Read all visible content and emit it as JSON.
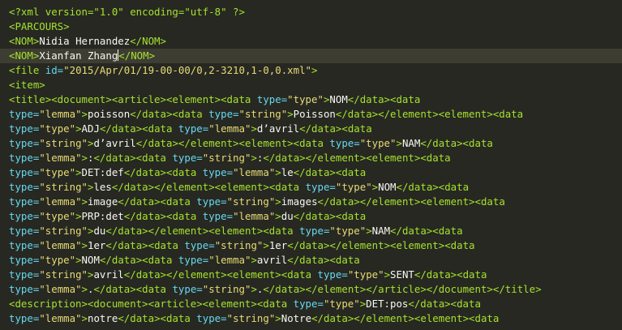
{
  "editor": {
    "theme_colors": {
      "background": "#272822",
      "tag": "#a6e22e",
      "text": "#f8f8f2",
      "attr_name": "#66d9ef",
      "attr_value": "#e6db74",
      "decl": "#a6e22e",
      "active_line": "#3e3d32"
    },
    "active_line_index": 3,
    "lines": [
      [
        {
          "t": "<?xml version=\"1.0\" encoding=\"utf-8\" ?>",
          "c": "decl"
        }
      ],
      [
        {
          "t": "<PARCOURS>",
          "c": "tag"
        }
      ],
      [
        {
          "t": "<NOM>",
          "c": "tag"
        },
        {
          "t": "Nidia Hernandez",
          "c": "text"
        },
        {
          "t": "</NOM>",
          "c": "tag"
        }
      ],
      [
        {
          "t": "<NOM>",
          "c": "tag"
        },
        {
          "t": "Xianfan Zhang",
          "c": "text"
        },
        {
          "t": "</NOM>",
          "c": "tag"
        }
      ],
      [
        {
          "t": "<file ",
          "c": "tag"
        },
        {
          "t": "id=",
          "c": "attr_name"
        },
        {
          "t": "\"2015/Apr/01/19-00-00/0,2-3210,1-0,0.xml\"",
          "c": "attr_value"
        },
        {
          "t": ">",
          "c": "tag"
        }
      ],
      [
        {
          "t": "<item>",
          "c": "tag"
        }
      ],
      [
        {
          "t": "<title><document><article><element><data ",
          "c": "tag"
        },
        {
          "t": "type=",
          "c": "attr_name"
        },
        {
          "t": "\"type\"",
          "c": "attr_value"
        },
        {
          "t": ">",
          "c": "tag"
        },
        {
          "t": "NOM",
          "c": "text"
        },
        {
          "t": "</data><data",
          "c": "tag"
        }
      ],
      [
        {
          "t": "type=",
          "c": "attr_name"
        },
        {
          "t": "\"lemma\"",
          "c": "attr_value"
        },
        {
          "t": ">",
          "c": "tag"
        },
        {
          "t": "poisson",
          "c": "text"
        },
        {
          "t": "</data><data ",
          "c": "tag"
        },
        {
          "t": "type=",
          "c": "attr_name"
        },
        {
          "t": "\"string\"",
          "c": "attr_value"
        },
        {
          "t": ">",
          "c": "tag"
        },
        {
          "t": "Poisson",
          "c": "text"
        },
        {
          "t": "</data></element><element><data",
          "c": "tag"
        }
      ],
      [
        {
          "t": "type=",
          "c": "attr_name"
        },
        {
          "t": "\"type\"",
          "c": "attr_value"
        },
        {
          "t": ">",
          "c": "tag"
        },
        {
          "t": "ADJ",
          "c": "text"
        },
        {
          "t": "</data><data ",
          "c": "tag"
        },
        {
          "t": "type=",
          "c": "attr_name"
        },
        {
          "t": "\"lemma\"",
          "c": "attr_value"
        },
        {
          "t": ">",
          "c": "tag"
        },
        {
          "t": "d’avril",
          "c": "text"
        },
        {
          "t": "</data><data",
          "c": "tag"
        }
      ],
      [
        {
          "t": "type=",
          "c": "attr_name"
        },
        {
          "t": "\"string\"",
          "c": "attr_value"
        },
        {
          "t": ">",
          "c": "tag"
        },
        {
          "t": "d’avril",
          "c": "text"
        },
        {
          "t": "</data></element><element><data ",
          "c": "tag"
        },
        {
          "t": "type=",
          "c": "attr_name"
        },
        {
          "t": "\"type\"",
          "c": "attr_value"
        },
        {
          "t": ">",
          "c": "tag"
        },
        {
          "t": "NAM",
          "c": "text"
        },
        {
          "t": "</data><data",
          "c": "tag"
        }
      ],
      [
        {
          "t": "type=",
          "c": "attr_name"
        },
        {
          "t": "\"lemma\"",
          "c": "attr_value"
        },
        {
          "t": ">",
          "c": "tag"
        },
        {
          "t": ":",
          "c": "text"
        },
        {
          "t": "</data><data ",
          "c": "tag"
        },
        {
          "t": "type=",
          "c": "attr_name"
        },
        {
          "t": "\"string\"",
          "c": "attr_value"
        },
        {
          "t": ">",
          "c": "tag"
        },
        {
          "t": ":",
          "c": "text"
        },
        {
          "t": "</data></element><element><data",
          "c": "tag"
        }
      ],
      [
        {
          "t": "type=",
          "c": "attr_name"
        },
        {
          "t": "\"type\"",
          "c": "attr_value"
        },
        {
          "t": ">",
          "c": "tag"
        },
        {
          "t": "DET:def",
          "c": "text"
        },
        {
          "t": "</data><data ",
          "c": "tag"
        },
        {
          "t": "type=",
          "c": "attr_name"
        },
        {
          "t": "\"lemma\"",
          "c": "attr_value"
        },
        {
          "t": ">",
          "c": "tag"
        },
        {
          "t": "le",
          "c": "text"
        },
        {
          "t": "</data><data",
          "c": "tag"
        }
      ],
      [
        {
          "t": "type=",
          "c": "attr_name"
        },
        {
          "t": "\"string\"",
          "c": "attr_value"
        },
        {
          "t": ">",
          "c": "tag"
        },
        {
          "t": "les",
          "c": "text"
        },
        {
          "t": "</data></element><element><data ",
          "c": "tag"
        },
        {
          "t": "type=",
          "c": "attr_name"
        },
        {
          "t": "\"type\"",
          "c": "attr_value"
        },
        {
          "t": ">",
          "c": "tag"
        },
        {
          "t": "NOM",
          "c": "text"
        },
        {
          "t": "</data><data",
          "c": "tag"
        }
      ],
      [
        {
          "t": "type=",
          "c": "attr_name"
        },
        {
          "t": "\"lemma\"",
          "c": "attr_value"
        },
        {
          "t": ">",
          "c": "tag"
        },
        {
          "t": "image",
          "c": "text"
        },
        {
          "t": "</data><data ",
          "c": "tag"
        },
        {
          "t": "type=",
          "c": "attr_name"
        },
        {
          "t": "\"string\"",
          "c": "attr_value"
        },
        {
          "t": ">",
          "c": "tag"
        },
        {
          "t": "images",
          "c": "text"
        },
        {
          "t": "</data></element><element><data",
          "c": "tag"
        }
      ],
      [
        {
          "t": "type=",
          "c": "attr_name"
        },
        {
          "t": "\"type\"",
          "c": "attr_value"
        },
        {
          "t": ">",
          "c": "tag"
        },
        {
          "t": "PRP:det",
          "c": "text"
        },
        {
          "t": "</data><data ",
          "c": "tag"
        },
        {
          "t": "type=",
          "c": "attr_name"
        },
        {
          "t": "\"lemma\"",
          "c": "attr_value"
        },
        {
          "t": ">",
          "c": "tag"
        },
        {
          "t": "du",
          "c": "text"
        },
        {
          "t": "</data><data",
          "c": "tag"
        }
      ],
      [
        {
          "t": "type=",
          "c": "attr_name"
        },
        {
          "t": "\"string\"",
          "c": "attr_value"
        },
        {
          "t": ">",
          "c": "tag"
        },
        {
          "t": "du",
          "c": "text"
        },
        {
          "t": "</data></element><element><data ",
          "c": "tag"
        },
        {
          "t": "type=",
          "c": "attr_name"
        },
        {
          "t": "\"type\"",
          "c": "attr_value"
        },
        {
          "t": ">",
          "c": "tag"
        },
        {
          "t": "NAM",
          "c": "text"
        },
        {
          "t": "</data><data",
          "c": "tag"
        }
      ],
      [
        {
          "t": "type=",
          "c": "attr_name"
        },
        {
          "t": "\"lemma\"",
          "c": "attr_value"
        },
        {
          "t": ">",
          "c": "tag"
        },
        {
          "t": "1er",
          "c": "text"
        },
        {
          "t": "</data><data ",
          "c": "tag"
        },
        {
          "t": "type=",
          "c": "attr_name"
        },
        {
          "t": "\"string\"",
          "c": "attr_value"
        },
        {
          "t": ">",
          "c": "tag"
        },
        {
          "t": "1er",
          "c": "text"
        },
        {
          "t": "</data></element><element><data",
          "c": "tag"
        }
      ],
      [
        {
          "t": "type=",
          "c": "attr_name"
        },
        {
          "t": "\"type\"",
          "c": "attr_value"
        },
        {
          "t": ">",
          "c": "tag"
        },
        {
          "t": "NOM",
          "c": "text"
        },
        {
          "t": "</data><data ",
          "c": "tag"
        },
        {
          "t": "type=",
          "c": "attr_name"
        },
        {
          "t": "\"lemma\"",
          "c": "attr_value"
        },
        {
          "t": ">",
          "c": "tag"
        },
        {
          "t": "avril",
          "c": "text"
        },
        {
          "t": "</data><data",
          "c": "tag"
        }
      ],
      [
        {
          "t": "type=",
          "c": "attr_name"
        },
        {
          "t": "\"string\"",
          "c": "attr_value"
        },
        {
          "t": ">",
          "c": "tag"
        },
        {
          "t": "avril",
          "c": "text"
        },
        {
          "t": "</data></element><element><data ",
          "c": "tag"
        },
        {
          "t": "type=",
          "c": "attr_name"
        },
        {
          "t": "\"type\"",
          "c": "attr_value"
        },
        {
          "t": ">",
          "c": "tag"
        },
        {
          "t": "SENT",
          "c": "text"
        },
        {
          "t": "</data><data",
          "c": "tag"
        }
      ],
      [
        {
          "t": "type=",
          "c": "attr_name"
        },
        {
          "t": "\"lemma\"",
          "c": "attr_value"
        },
        {
          "t": ">",
          "c": "tag"
        },
        {
          "t": ".",
          "c": "text"
        },
        {
          "t": "</data><data ",
          "c": "tag"
        },
        {
          "t": "type=",
          "c": "attr_name"
        },
        {
          "t": "\"string\"",
          "c": "attr_value"
        },
        {
          "t": ">",
          "c": "tag"
        },
        {
          "t": ".",
          "c": "text"
        },
        {
          "t": "</data></element></article></document></title>",
          "c": "tag"
        }
      ],
      [
        {
          "t": "<description><document><article><element><data ",
          "c": "tag"
        },
        {
          "t": "type=",
          "c": "attr_name"
        },
        {
          "t": "\"type\"",
          "c": "attr_value"
        },
        {
          "t": ">",
          "c": "tag"
        },
        {
          "t": "DET:pos",
          "c": "text"
        },
        {
          "t": "</data><data",
          "c": "tag"
        }
      ],
      [
        {
          "t": "type=",
          "c": "attr_name"
        },
        {
          "t": "\"lemma\"",
          "c": "attr_value"
        },
        {
          "t": ">",
          "c": "tag"
        },
        {
          "t": "notre",
          "c": "text"
        },
        {
          "t": "</data><data ",
          "c": "tag"
        },
        {
          "t": "type=",
          "c": "attr_name"
        },
        {
          "t": "\"string\"",
          "c": "attr_value"
        },
        {
          "t": ">",
          "c": "tag"
        },
        {
          "t": "Notre",
          "c": "text"
        },
        {
          "t": "</data></element><element><data",
          "c": "tag"
        }
      ]
    ]
  }
}
